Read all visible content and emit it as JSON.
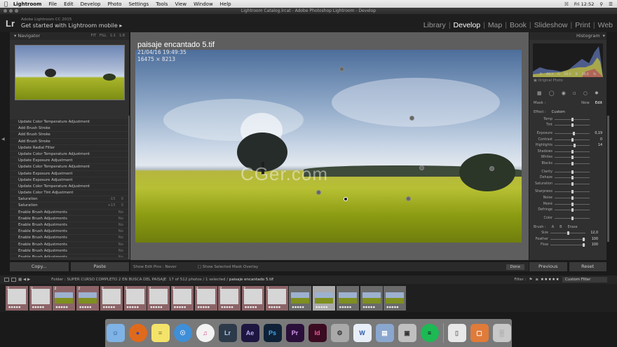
{
  "menubar": {
    "items": [
      "Lightroom",
      "File",
      "Edit",
      "Develop",
      "Photo",
      "Settings",
      "Tools",
      "View",
      "Window",
      "Help"
    ],
    "clock": "Fri 12:52"
  },
  "window": {
    "title": "Lightroom Catalog.lrcat - Adobe Photoshop Lightroom - Develop"
  },
  "identity": {
    "logo": "Lr",
    "line1": "Adobe Lightroom CC 2015",
    "line2": "Get started with Lightroom mobile  ▸"
  },
  "modules": [
    {
      "label": "Library",
      "active": false
    },
    {
      "label": "Develop",
      "active": true
    },
    {
      "label": "Map",
      "active": false
    },
    {
      "label": "Book",
      "active": false
    },
    {
      "label": "Slideshow",
      "active": false
    },
    {
      "label": "Print",
      "active": false
    },
    {
      "label": "Web",
      "active": false
    }
  ],
  "navigator": {
    "title": "Navigator",
    "options": [
      "FIT",
      "FILL",
      "1:1",
      "1:8"
    ]
  },
  "history": [
    {
      "label": "Update Color Temperature Adjustment",
      "a": "",
      "b": ""
    },
    {
      "label": "Add Brush Stroke",
      "a": "",
      "b": ""
    },
    {
      "label": "Add Brush Stroke",
      "a": "",
      "b": ""
    },
    {
      "label": "Add Brush Stroke",
      "a": "",
      "b": ""
    },
    {
      "label": "Update Radial Filter",
      "a": "",
      "b": ""
    },
    {
      "label": "Update Color Temperature Adjustment",
      "a": "",
      "b": ""
    },
    {
      "label": "Update Exposure Adjustment",
      "a": "",
      "b": ""
    },
    {
      "label": "Update Color Temperature Adjustment",
      "a": "",
      "b": ""
    },
    {
      "label": "Update Exposure Adjustment",
      "a": "",
      "b": ""
    },
    {
      "label": "Update Exposure Adjustment",
      "a": "",
      "b": ""
    },
    {
      "label": "Update Color Temperature Adjustment",
      "a": "",
      "b": ""
    },
    {
      "label": "Update Color Tint Adjustment",
      "a": "",
      "b": ""
    },
    {
      "label": "Saturation",
      "a": "-15",
      "b": "0"
    },
    {
      "label": "Saturation",
      "a": "+15",
      "b": "0"
    },
    {
      "label": "Enable Brush Adjustments",
      "a": "",
      "b": "No"
    },
    {
      "label": "Enable Brush Adjustments",
      "a": "",
      "b": "No"
    },
    {
      "label": "Enable Brush Adjustments",
      "a": "",
      "b": "No"
    },
    {
      "label": "Enable Brush Adjustments",
      "a": "",
      "b": "No"
    },
    {
      "label": "Enable Brush Adjustments",
      "a": "",
      "b": "No"
    },
    {
      "label": "Enable Brush Adjustments",
      "a": "",
      "b": "No"
    },
    {
      "label": "Enable Brush Adjustments",
      "a": "",
      "b": "No"
    },
    {
      "label": "Enable Brush Adjustments",
      "a": "",
      "b": "No"
    }
  ],
  "left_buttons": {
    "copy": "Copy...",
    "paste": "Paste"
  },
  "photo": {
    "filename": "paisaje encantado 5.tif",
    "datetime": "21/04/16 19:49:35",
    "dimensions": "16475 × 8213",
    "watermark": "CGer.com"
  },
  "toolbar": {
    "edit_pins": "Show Edit Pins :",
    "edit_pins_value": "Never",
    "mask_overlay": "Show Selected Mask Overlay",
    "done": "Done"
  },
  "histogram": {
    "title": "Histogram",
    "values": [
      "R",
      "69,3",
      "G",
      "66,0",
      "B",
      "20,6",
      "%"
    ],
    "original": "Original Photo"
  },
  "tools_icons": [
    "crop-icon",
    "spot-removal-icon",
    "red-eye-icon",
    "graduated-filter-icon",
    "radial-filter-icon",
    "adjustment-brush-icon"
  ],
  "mask": {
    "label": "Mask :",
    "new": "New",
    "edit": "Edit"
  },
  "effect": {
    "label": "Effect :",
    "value": "Custom"
  },
  "sliders": [
    {
      "label": "Temp",
      "value": "",
      "pos": 50,
      "gap": false
    },
    {
      "label": "Tint",
      "value": "",
      "pos": 50,
      "gap": false
    },
    {
      "label": "Exposure",
      "value": "0,19",
      "pos": 55,
      "gap": true
    },
    {
      "label": "Contrast",
      "value": "0",
      "pos": 50,
      "gap": false
    },
    {
      "label": "Highlights",
      "value": "14",
      "pos": 57,
      "gap": false
    },
    {
      "label": "Shadows",
      "value": "",
      "pos": 50,
      "gap": false
    },
    {
      "label": "Whites",
      "value": "",
      "pos": 50,
      "gap": false
    },
    {
      "label": "Blacks",
      "value": "",
      "pos": 50,
      "gap": false
    },
    {
      "label": "Clarity",
      "value": "",
      "pos": 50,
      "gap": true
    },
    {
      "label": "Dehaze",
      "value": "",
      "pos": 50,
      "gap": false
    },
    {
      "label": "Saturation",
      "value": "",
      "pos": 50,
      "gap": false
    },
    {
      "label": "Sharpness",
      "value": "",
      "pos": 50,
      "gap": true
    },
    {
      "label": "Noise",
      "value": "",
      "pos": 50,
      "gap": false
    },
    {
      "label": "Moiré",
      "value": "",
      "pos": 50,
      "gap": false
    },
    {
      "label": "Defringe",
      "value": "",
      "pos": 50,
      "gap": false
    },
    {
      "label": "Color",
      "value": "",
      "pos": 50,
      "gap": true
    }
  ],
  "brush": {
    "label": "Brush :",
    "a": "A",
    "b": "B",
    "erase": "Erase",
    "size_label": "Size",
    "size": "12,0",
    "feather_label": "Feather",
    "feather": "100",
    "flow_label": "Flow",
    "flow": "100"
  },
  "right_buttons": {
    "previous": "Previous",
    "reset": "Reset"
  },
  "filmbar": {
    "folder_label": "Folder : SUPER CURSO COMPLETO 2 EN BUSCA DEL PAISAJE",
    "counts": "17 of 512 photos / 1 selected /",
    "selected_name": "paisaje encantado 5.tif",
    "filter_label": "Filter :",
    "stars": "≥ ★★★★★",
    "custom_filter": "Custom Filter"
  },
  "filmstrip": [
    {
      "kind": "doc",
      "badge": "2"
    },
    {
      "kind": "doc",
      "badge": "2"
    },
    {
      "kind": "land",
      "badge": "2"
    },
    {
      "kind": "land",
      "badge": "2"
    },
    {
      "kind": "doc",
      "badge": "2"
    },
    {
      "kind": "doc",
      "badge": "2"
    },
    {
      "kind": "doc",
      "badge": "2"
    },
    {
      "kind": "doc",
      "badge": "2"
    },
    {
      "kind": "doc",
      "badge": "2"
    },
    {
      "kind": "doc",
      "badge": "2"
    },
    {
      "kind": "doc",
      "badge": "2"
    },
    {
      "kind": "doc",
      "badge": "2"
    },
    {
      "kind": "land",
      "badge": ""
    },
    {
      "kind": "land",
      "badge": ""
    },
    {
      "kind": "land",
      "badge": ""
    },
    {
      "kind": "land",
      "badge": ""
    },
    {
      "kind": "land",
      "badge": ""
    }
  ],
  "dock": [
    {
      "name": "finder",
      "glyph": "☺",
      "bg": "#7fb3e6",
      "fg": "#1d4f86"
    },
    {
      "name": "firefox",
      "glyph": "●",
      "bg": "#e06a1b",
      "fg": "#3a4aa8"
    },
    {
      "name": "stickies",
      "glyph": "≡",
      "bg": "#f3e36b",
      "fg": "#8a7b2a"
    },
    {
      "name": "safari",
      "glyph": "☉",
      "bg": "#3f8fd8",
      "fg": "#ffffff"
    },
    {
      "name": "itunes",
      "glyph": "♫",
      "bg": "#f2f2f2",
      "fg": "#d7407a"
    },
    {
      "name": "lightroom",
      "glyph": "Lr",
      "bg": "#2d3a4a",
      "fg": "#a8c8e8"
    },
    {
      "name": "after-effects",
      "glyph": "Ae",
      "bg": "#1d1640",
      "fg": "#b9a6f2"
    },
    {
      "name": "photoshop",
      "glyph": "Ps",
      "bg": "#0f2137",
      "fg": "#3ca8f0"
    },
    {
      "name": "premiere",
      "glyph": "Pr",
      "bg": "#2a0f3a",
      "fg": "#d39af0"
    },
    {
      "name": "indesign",
      "glyph": "Id",
      "bg": "#3b0b22",
      "fg": "#f05a9a"
    },
    {
      "name": "utility",
      "glyph": "⚙",
      "bg": "#a9a9a9",
      "fg": "#333333"
    },
    {
      "name": "word",
      "glyph": "W",
      "bg": "#e8eef8",
      "fg": "#2b5aa8"
    },
    {
      "name": "preview",
      "glyph": "▤",
      "bg": "#8aa7cf",
      "fg": "#ffffff"
    },
    {
      "name": "photo-booth",
      "glyph": "▣",
      "bg": "#c0c0c0",
      "fg": "#333333"
    },
    {
      "name": "spotify",
      "glyph": "≡",
      "bg": "#1db954",
      "fg": "#111111"
    },
    {
      "name": "documents",
      "glyph": "▯",
      "bg": "#e8e8e8",
      "fg": "#777777"
    },
    {
      "name": "downloads",
      "glyph": "▢",
      "bg": "#e07b3a",
      "fg": "#ffffff"
    },
    {
      "name": "trash",
      "glyph": "░",
      "bg": "#c8c8c8",
      "fg": "#555555"
    }
  ]
}
